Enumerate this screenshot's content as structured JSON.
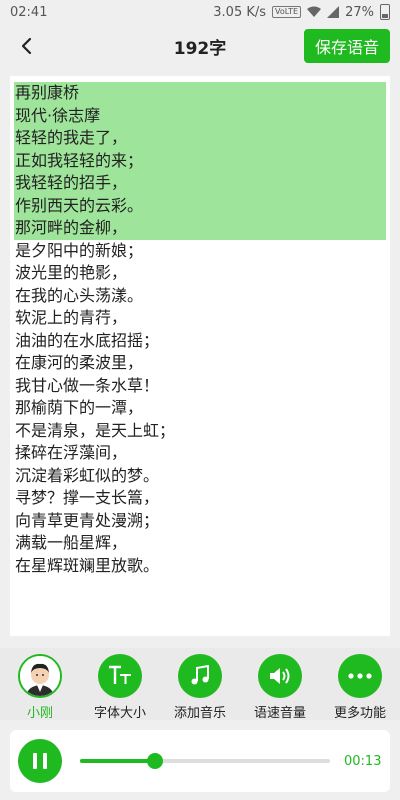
{
  "status": {
    "time": "02:41",
    "speed": "3.05 K/s",
    "volte": "VoLTE",
    "battery": "27%"
  },
  "header": {
    "title": "192字",
    "save_label": "保存语音"
  },
  "poem": {
    "lines": [
      "再别康桥",
      "现代·徐志摩",
      "轻轻的我走了，",
      "正如我轻轻的来；",
      "我轻轻的招手，",
      "作别西天的云彩。",
      "那河畔的金柳，",
      "是夕阳中的新娘；",
      "波光里的艳影，",
      "在我的心头荡漾。",
      "软泥上的青荇，",
      "油油的在水底招摇；",
      "在康河的柔波里，",
      "我甘心做一条水草！",
      "那榆荫下的一潭，",
      "不是清泉，是天上虹；",
      "揉碎在浮藻间，",
      "沉淀着彩虹似的梦。",
      "寻梦？撑一支长篙，",
      "向青草更青处漫溯；",
      "满载一船星辉，",
      "在星辉斑斓里放歌。"
    ],
    "highlighted_count": 7
  },
  "tools": [
    {
      "label": "小刚",
      "icon": "avatar-icon"
    },
    {
      "label": "字体大小",
      "icon": "font-size-icon"
    },
    {
      "label": "添加音乐",
      "icon": "music-note-icon"
    },
    {
      "label": "语速音量",
      "icon": "volume-icon"
    },
    {
      "label": "更多功能",
      "icon": "more-icon"
    }
  ],
  "player": {
    "time": "00:13",
    "progress": 0.3
  },
  "colors": {
    "accent": "#1fb920",
    "highlight": "#9ee49a"
  }
}
